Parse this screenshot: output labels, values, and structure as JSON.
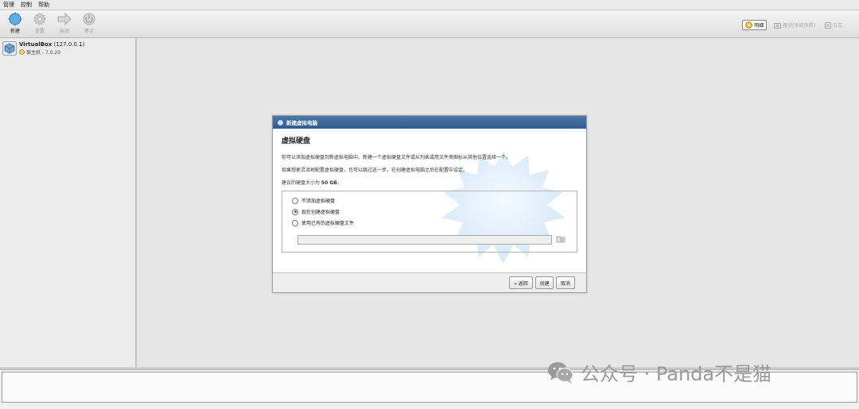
{
  "menu": [
    "管理",
    "控制",
    "帮助"
  ],
  "toolbar": {
    "new": "新建",
    "settings": "设置",
    "start": "启动",
    "stop": "停止"
  },
  "tools": {
    "details": "明细",
    "snapshots": "备份[系统快照]",
    "logs": "日志"
  },
  "vm": {
    "name": "VirtualBox",
    "address": "(127.0.0.1)",
    "sub": "宿主机 - 7.0.20"
  },
  "wizard": {
    "title": "新建虚拟电脑",
    "heading": "虚拟硬盘",
    "p1": "你可以添加虚拟硬盘到新虚拟电脑中。新建一个虚拟硬盘文件或从列表或用文件夹图标从其他位置选择一个。",
    "p2": "如果想更灵活地配置虚拟硬盘，也可以跳过这一步，在创建虚拟电脑之后在配置中设定。",
    "p3_prefix": "建议的硬盘大小为 ",
    "p3_size": "50 GB",
    "p3_suffix": "。",
    "options": [
      "不添加虚拟硬盘",
      "现在创建虚拟硬盘",
      "使用已有的虚拟硬盘文件"
    ],
    "selected_option": 1,
    "file_value": "",
    "back": "« 返回",
    "create": "创建",
    "cancel": "取消"
  },
  "watermark": "公众号 · Panda不是猫",
  "colors": {
    "title_bar": "#2f5c8e",
    "radio_accent": "#2a5ea8"
  }
}
